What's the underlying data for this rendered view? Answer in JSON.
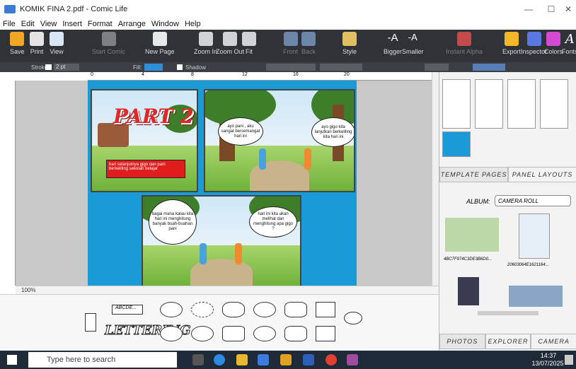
{
  "window": {
    "title": "KOMIK FINA 2.pdf - Comic Life",
    "min": "—",
    "max": "☐",
    "close": "✕"
  },
  "menu": [
    "File",
    "Edit",
    "View",
    "Insert",
    "Format",
    "Arrange",
    "Window",
    "Help"
  ],
  "toolbar": {
    "items": [
      {
        "label": "Save",
        "color": "#f2a626",
        "dim": false
      },
      {
        "label": "Print",
        "color": "#e4e4e4",
        "dim": false
      },
      {
        "label": "View",
        "color": "#d9e6f4",
        "dim": false
      },
      {
        "label": "Start Comic",
        "color": "#7d8085",
        "dim": true
      },
      {
        "label": "New Page",
        "color": "#e8e8e8",
        "dim": false
      },
      {
        "label": "Zoom In",
        "color": "#cfd3d8",
        "dim": false
      },
      {
        "label": "Zoom Out",
        "color": "#cfd3d8",
        "dim": false
      },
      {
        "label": "Fit",
        "color": "#cfd3d8",
        "dim": false
      },
      {
        "label": "Front",
        "color": "#6b86a8",
        "dim": true
      },
      {
        "label": "Back",
        "color": "#6b86a8",
        "dim": true
      },
      {
        "label": "Style",
        "color": "#e0c060",
        "dim": false
      },
      {
        "label": "Bigger",
        "color": "#2f3237",
        "dim": false
      },
      {
        "label": "Smaller",
        "color": "#2f3237",
        "dim": false
      },
      {
        "label": "Instant Alpha",
        "color": "#c24a4a",
        "dim": true
      },
      {
        "label": "Export",
        "color": "#f2b82a",
        "dim": false
      },
      {
        "label": "Inspector",
        "color": "#5a78e0",
        "dim": false
      },
      {
        "label": "Colors",
        "color": "#d44ad0",
        "dim": false
      },
      {
        "label": "Fonts",
        "color": "#2f3237",
        "dim": false
      }
    ],
    "bigger_glyph": "-A",
    "smaller_glyph": "-A",
    "fonts_glyph": "A"
  },
  "stylebar": {
    "stroke_label": "Stroke:",
    "stroke_value": "2 pt",
    "fill_label": "Fill:",
    "shadow_label": "Shadow"
  },
  "ruler": {
    "marks": [
      "0",
      "4",
      "8",
      "12",
      "16",
      "20"
    ]
  },
  "comic": {
    "part_title": "PART 2",
    "caption": "hari selanjutnya gigo dan pani berkeliling sekolah belajar",
    "bubble1": "ayo pani , aku sangat bersemangat hari ini",
    "bubble2": "ayo gigo kita lanjutkan berkeliling kita hari ini",
    "bubble3": "bagai mana kalau kita hari ini menghitung banyak buah-buahan pani",
    "bubble4": "hari ini kita akan melihat dan menghitung apa gigo ?"
  },
  "zoom": "100%",
  "lettering": {
    "abcde": "ABCDE...",
    "word": "LETTERING"
  },
  "right_panel": {
    "tab_template": "TEMPLATE PAGES",
    "tab_layouts": "PANEL LAYOUTS",
    "album_label": "ALBUM:",
    "album_value": "CAMERA ROLL",
    "photo1_name": "4BC7F974C3DE3B6D0...",
    "photo2_name": "20603064E1621164...",
    "bottom_tabs": [
      "PHOTOS",
      "EXPLORER",
      "CAMERA"
    ]
  },
  "taskbar": {
    "search_placeholder": "Type here to search",
    "time": "14:37",
    "date": "13/07/2025"
  }
}
